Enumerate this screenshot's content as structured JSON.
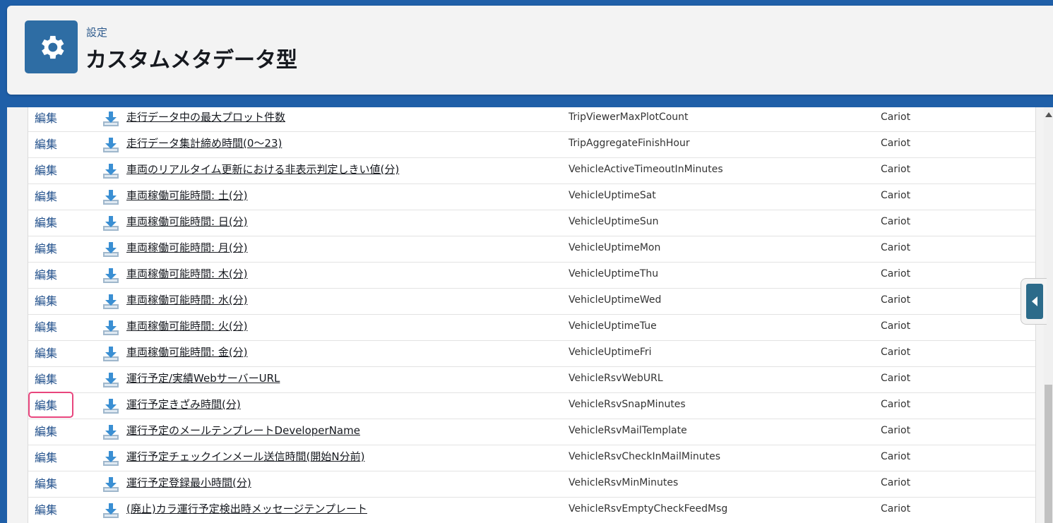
{
  "header": {
    "breadcrumb": "設定",
    "title": "カスタムメタデータ型",
    "icon": "gear-icon"
  },
  "colors": {
    "background": "#1f5fa8",
    "icon_tile": "#2e6da4",
    "link": "#23518c",
    "highlight": "#e8457d"
  },
  "table": {
    "edit_label": "編集",
    "highlighted_row": 11,
    "rows": [
      {
        "label": "走行データ中の最大プロット件数",
        "api_name": "TripViewerMaxPlotCount",
        "namespace": "Cariot"
      },
      {
        "label": "走行データ集計締め時間(0〜23)",
        "api_name": "TripAggregateFinishHour",
        "namespace": "Cariot"
      },
      {
        "label": "車両のリアルタイム更新における非表示判定しきい値(分)",
        "api_name": "VehicleActiveTimeoutInMinutes",
        "namespace": "Cariot"
      },
      {
        "label": "車両稼働可能時間: 土(分)",
        "api_name": "VehicleUptimeSat",
        "namespace": "Cariot"
      },
      {
        "label": "車両稼働可能時間: 日(分)",
        "api_name": "VehicleUptimeSun",
        "namespace": "Cariot"
      },
      {
        "label": "車両稼働可能時間: 月(分)",
        "api_name": "VehicleUptimeMon",
        "namespace": "Cariot"
      },
      {
        "label": "車両稼働可能時間: 木(分)",
        "api_name": "VehicleUptimeThu",
        "namespace": "Cariot"
      },
      {
        "label": "車両稼働可能時間: 水(分)",
        "api_name": "VehicleUptimeWed",
        "namespace": "Cariot"
      },
      {
        "label": "車両稼働可能時間: 火(分)",
        "api_name": "VehicleUptimeTue",
        "namespace": "Cariot"
      },
      {
        "label": "車両稼働可能時間: 金(分)",
        "api_name": "VehicleUptimeFri",
        "namespace": "Cariot"
      },
      {
        "label": "運行予定/実績WebサーバーURL",
        "api_name": "VehicleRsvWebURL",
        "namespace": "Cariot"
      },
      {
        "label": "運行予定きざみ時間(分)",
        "api_name": "VehicleRsvSnapMinutes",
        "namespace": "Cariot"
      },
      {
        "label": "運行予定のメールテンプレートDeveloperName",
        "api_name": "VehicleRsvMailTemplate",
        "namespace": "Cariot"
      },
      {
        "label": "運行予定チェックインメール送信時間(開始N分前)",
        "api_name": "VehicleRsvCheckInMailMinutes",
        "namespace": "Cariot"
      },
      {
        "label": "運行予定登録最小時間(分)",
        "api_name": "VehicleRsvMinMinutes",
        "namespace": "Cariot"
      },
      {
        "label": "(廃止)カラ運行予定検出時メッセージテンプレート",
        "api_name": "VehicleRsvEmptyCheckFeedMsg",
        "namespace": "Cariot"
      }
    ]
  }
}
